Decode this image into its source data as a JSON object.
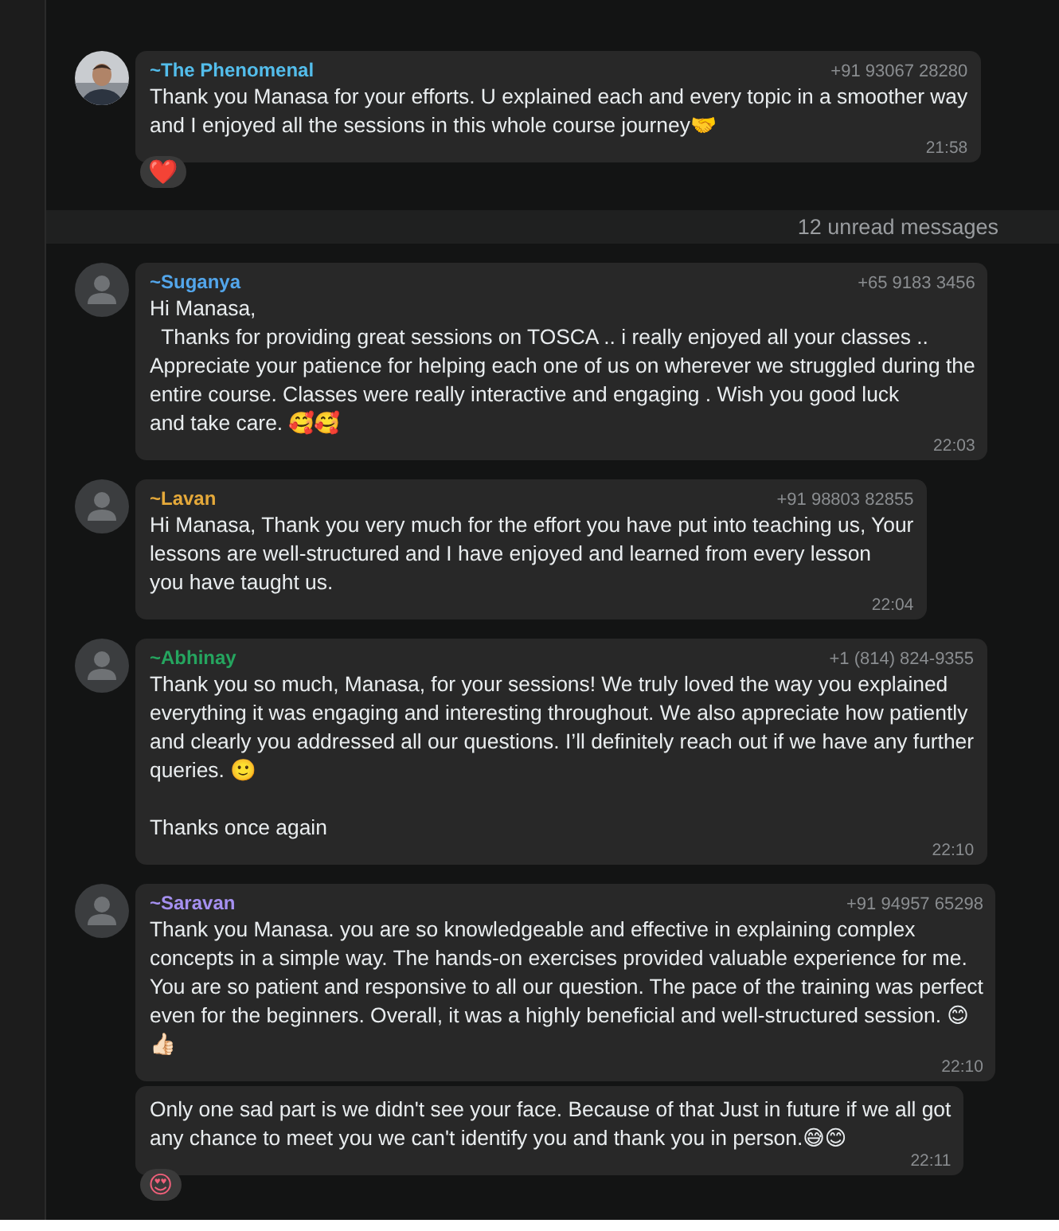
{
  "messages": [
    {
      "kind": "message",
      "sender": "~The Phenomenal",
      "color": "#53bdeb",
      "phone": "+91 93067 28280",
      "text": "Thank you Manasa for your efforts. U explained each and every topic in a smoother way\nand I enjoyed all the sessions in this whole course journey🤝",
      "time": "21:58",
      "reaction": "❤️"
    },
    {
      "kind": "divider",
      "text": "12 unread messages"
    },
    {
      "kind": "message",
      "avatar": {
        "kind": "silhouette"
      },
      "sender": "~Suganya",
      "color": "#53a6eb",
      "phone": "+65 9183 3456",
      "text": "Hi Manasa,\n  Thanks for providing great sessions on TOSCA .. i really enjoyed all your classes ..\nAppreciate your patience for helping each one of us on wherever we struggled during the\nentire course. Classes were really interactive and engaging . Wish you good luck\nand take care. 🥰🥰",
      "time": "22:03"
    },
    {
      "kind": "message",
      "avatar": {
        "kind": "silhouette"
      },
      "sender": "~Lavan",
      "color": "#e5a93a",
      "phone": "+91 98803 82855",
      "text": "Hi Manasa, Thank you very much for the effort you have put into teaching us, Your\nlessons are well-structured and I have enjoyed and learned from every lesson\nyou have taught us.",
      "time": "22:04"
    },
    {
      "kind": "message",
      "avatar": {
        "kind": "silhouette"
      },
      "sender": "~Abhinay",
      "color": "#25a55f",
      "phone": "+1 (814) 824-9355",
      "text": "Thank you so much, Manasa, for your sessions! We truly loved the way you explained\neverything it was engaging and interesting throughout. We also appreciate how patiently\nand clearly you addressed all our questions. I’ll definitely reach out if we have any further\nqueries. 🙂\n\nThanks once again",
      "time": "22:10"
    },
    {
      "kind": "message",
      "avatar": {
        "kind": "silhouette"
      },
      "sender": "~Saravan",
      "color": "#a590f0",
      "phone": "+91 94957 65298",
      "text": "Thank you Manasa. you are so knowledgeable and effective in explaining complex\nconcepts in a simple way. The hands-on exercises provided valuable experience for me.\nYou are so patient and responsive to all our question. The pace of the training was perfect\neven for the beginners. Overall, it was a highly beneficial and well-structured session. 😊\n👍🏻",
      "time": "22:10"
    },
    {
      "kind": "continuation",
      "text": "Only one sad part is we didn't see your face. Because of that Just in future if we all got\nany chance to meet you we can't identify you and thank you in person.😅😊",
      "time": "22:11",
      "reaction": "😍"
    }
  ]
}
